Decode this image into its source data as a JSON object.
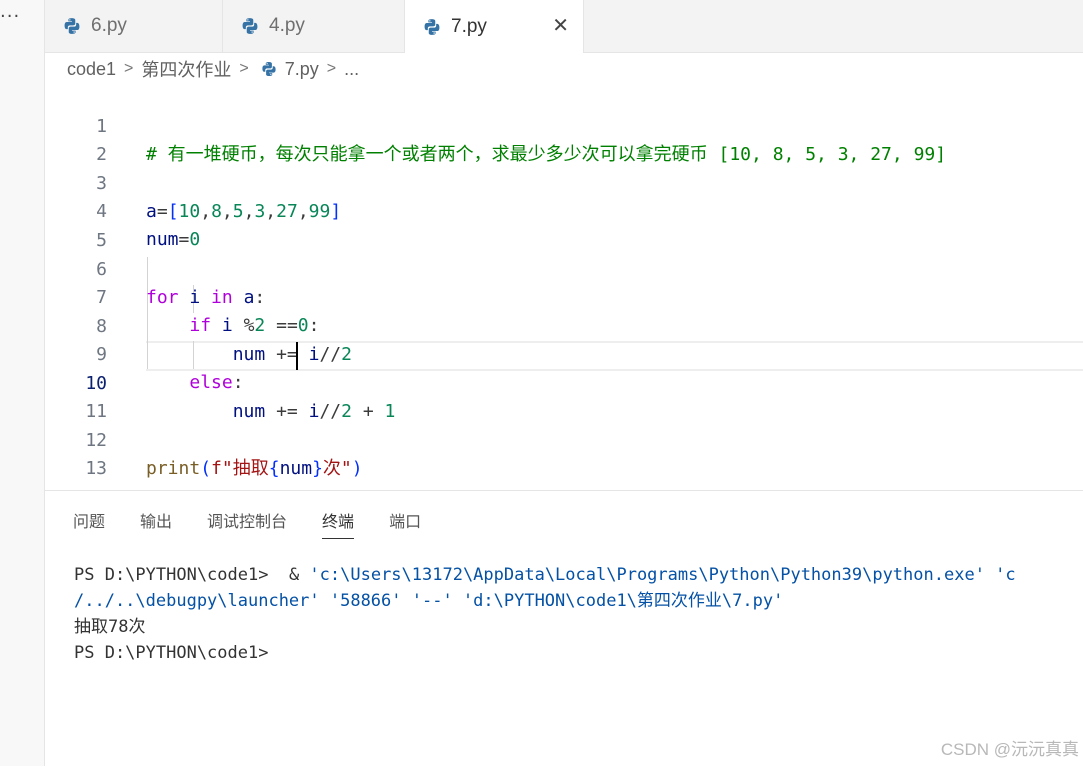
{
  "left": {
    "more": "···"
  },
  "tabs": [
    {
      "label": "6.py"
    },
    {
      "label": "4.py"
    },
    {
      "label": "7.py",
      "close": "✕"
    }
  ],
  "breadcrumb": {
    "root": "code1",
    "folder": "第四次作业",
    "file": "7.py",
    "more": "..."
  },
  "editor": {
    "current_line": 10,
    "lines": [
      {
        "n": "1"
      },
      {
        "n": "2"
      },
      {
        "n": "3"
      },
      {
        "n": "4"
      },
      {
        "n": "5"
      },
      {
        "n": "6"
      },
      {
        "n": "7"
      },
      {
        "n": "8"
      },
      {
        "n": "9"
      },
      {
        "n": "10"
      },
      {
        "n": "11"
      },
      {
        "n": "12"
      },
      {
        "n": "13"
      }
    ],
    "tokens": {
      "l1": "# 有一堆硬币，每次只能拿一个或者两个，求最少多少次可以拿完硬币 [10, 8, 5, 3, 27, 99]",
      "l3a": "a",
      "l3b": "=",
      "l3c": "[",
      "l3d": "10",
      "l3e": ",",
      "l3f": "8",
      "l3g": ",",
      "l3h": "5",
      "l3i": ",",
      "l3j": "3",
      "l3k": ",",
      "l3l": "27",
      "l3m": ",",
      "l3n": "99",
      "l3o": "]",
      "l4a": "num",
      "l4b": "=",
      "l4c": "0",
      "l6a": "for",
      "l6b": "i",
      "l6c": "in",
      "l6d": "a",
      "l6e": ":",
      "l7a": "if",
      "l7b": "i",
      "l7c": "%",
      "l7d": "2",
      "l7e": "==",
      "l7f": "0",
      "l7g": ":",
      "l8a": "num",
      "l8b": "+=",
      "l8c": "i",
      "l8d": "//",
      "l8e": "2",
      "l9a": "else",
      "l9b": ":",
      "l10a": "num",
      "l10b": "+=",
      "l10c": "i",
      "l10d": "//",
      "l10e": "2",
      "l10f": "+",
      "l10g": "1",
      "l12a": "print",
      "l12b": "(",
      "l12c": "f\"抽取",
      "l12d": "{",
      "l12e": "num",
      "l12f": "}",
      "l12g": "次\"",
      "l12h": ")"
    }
  },
  "panel": {
    "tabs": [
      "问题",
      "输出",
      "调试控制台",
      "终端",
      "端口"
    ],
    "active_tab": "终端",
    "terminal": {
      "l1_prompt": "PS D:\\PYTHON\\code1> ",
      "l1_cmd": " & ",
      "l1_path": "'c:\\Users\\13172\\AppData\\Local\\Programs\\Python\\Python39\\python.exe' 'c",
      "l2_path": "/../..\\debugpy\\launcher' '58866' '--' 'd:\\PYTHON\\code1\\第四次作业\\7.py'",
      "l3": "抽取78次",
      "l4": "PS D:\\PYTHON\\code1> "
    }
  },
  "watermark": "CSDN @沅沅真真",
  "colors": {
    "keyword": "#af00db",
    "variable": "#001080",
    "number": "#098658",
    "comment": "#008000",
    "string": "#a31515",
    "function": "#795e26",
    "bracket": "#0431fa"
  }
}
